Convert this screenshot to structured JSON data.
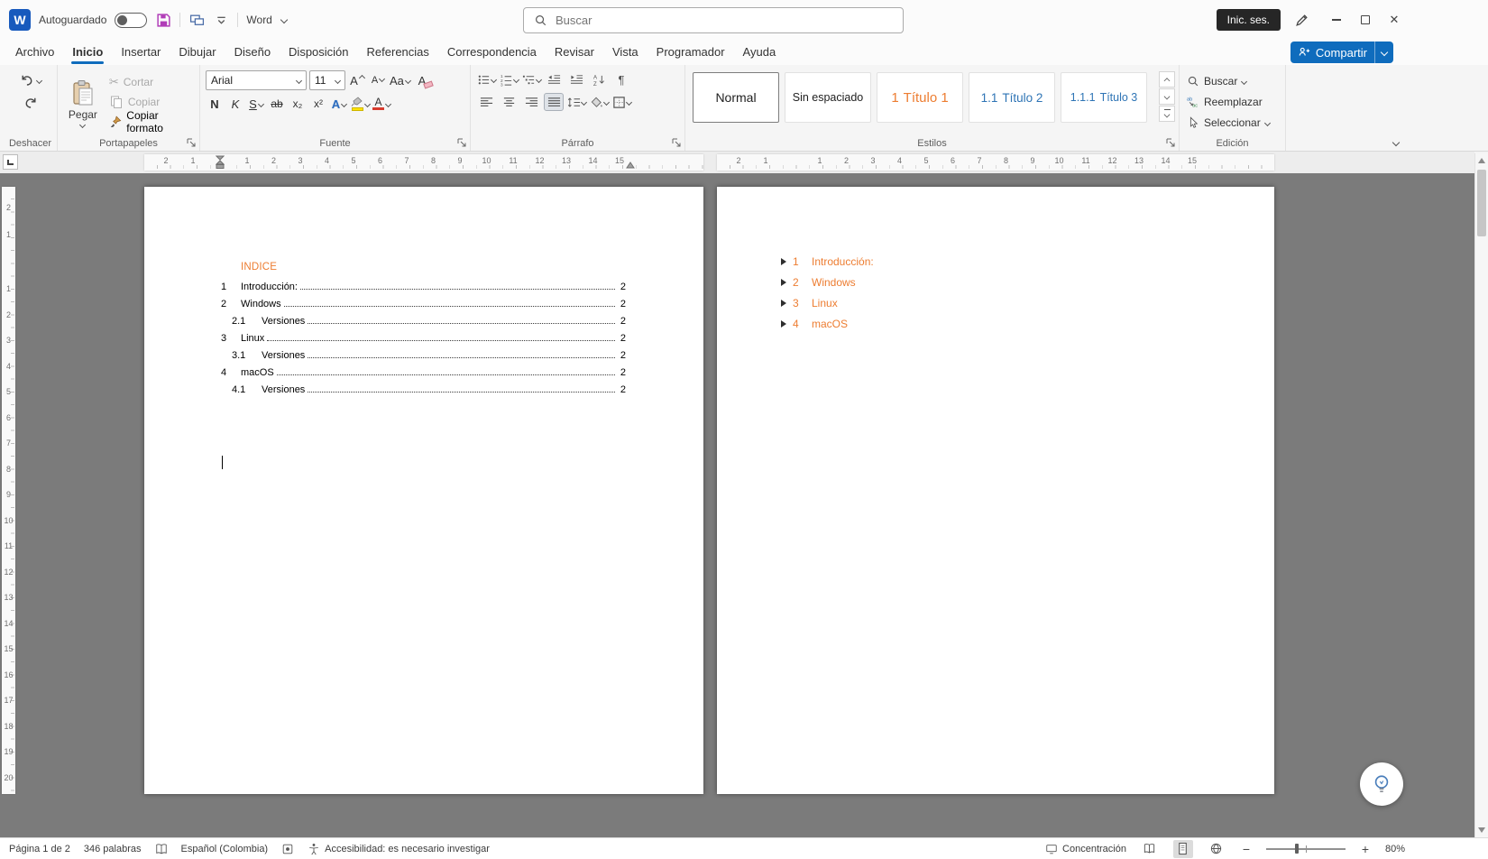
{
  "titlebar": {
    "autosave": "Autoguardado",
    "app_name": "Word",
    "search_placeholder": "Buscar",
    "signin": "Inic. ses."
  },
  "tabs": [
    {
      "label": "Archivo"
    },
    {
      "label": "Inicio"
    },
    {
      "label": "Insertar"
    },
    {
      "label": "Dibujar"
    },
    {
      "label": "Diseño"
    },
    {
      "label": "Disposición"
    },
    {
      "label": "Referencias"
    },
    {
      "label": "Correspondencia"
    },
    {
      "label": "Revisar"
    },
    {
      "label": "Vista"
    },
    {
      "label": "Programador"
    },
    {
      "label": "Ayuda"
    }
  ],
  "share": {
    "label": "Compartir"
  },
  "ribbon": {
    "groups": {
      "undo": "Deshacer",
      "clipboard": "Portapapeles",
      "font": "Fuente",
      "paragraph": "Párrafo",
      "styles": "Estilos",
      "editing": "Edición"
    },
    "clipboard": {
      "paste": "Pegar",
      "cut": "Cortar",
      "copy": "Copiar",
      "format_painter": "Copiar formato"
    },
    "font": {
      "family": "Arial",
      "size": "11",
      "grow": "A",
      "shrink": "A",
      "change_case": "Aa",
      "bold": "N",
      "italic": "K",
      "underline": "S",
      "strike": "ab",
      "subscript": "x₂",
      "superscript": "x²",
      "effects": "A",
      "font_color": "A"
    },
    "styles": [
      {
        "prefix": "",
        "label": "Normal"
      },
      {
        "prefix": "",
        "label": "Sin espaciado"
      },
      {
        "prefix": "1",
        "label": "Título 1"
      },
      {
        "prefix": "1.1",
        "label": "Título 2"
      },
      {
        "prefix": "1.1.1",
        "label": "Título 3"
      }
    ],
    "editing": {
      "find": "Buscar",
      "replace": "Reemplazar",
      "select": "Seleccionar"
    }
  },
  "ruler": {
    "h_numbers": [
      "1",
      "2",
      "3",
      "4",
      "5",
      "6",
      "7",
      "8",
      "9",
      "10",
      "11",
      "12",
      "13",
      "14",
      "15"
    ],
    "h_margin": [
      "2",
      "1"
    ],
    "v_numbers": [
      "1",
      "2",
      "3",
      "4",
      "5",
      "6",
      "7",
      "8",
      "9",
      "10",
      "11",
      "12",
      "13",
      "14",
      "15",
      "16",
      "17",
      "18",
      "19",
      "20"
    ],
    "v_margin": [
      "2",
      "1"
    ]
  },
  "document": {
    "title": "INDICE",
    "toc": [
      {
        "num": "1",
        "label": "Introducción:",
        "page": "2",
        "level": 0
      },
      {
        "num": "2",
        "label": "Windows",
        "page": "2",
        "level": 0
      },
      {
        "num": "2.1",
        "label": "Versiones",
        "page": "2",
        "level": 1
      },
      {
        "num": "3",
        "label": "Linux",
        "page": "2",
        "level": 0
      },
      {
        "num": "3.1",
        "label": "Versiones",
        "page": "2",
        "level": 1
      },
      {
        "num": "4",
        "label": "macOS",
        "page": "2",
        "level": 0
      },
      {
        "num": "4.1",
        "label": "Versiones",
        "page": "2",
        "level": 1
      }
    ],
    "outline": [
      {
        "num": "1",
        "label": "Introducción:"
      },
      {
        "num": "2",
        "label": "Windows"
      },
      {
        "num": "3",
        "label": "Linux"
      },
      {
        "num": "4",
        "label": "macOS"
      }
    ]
  },
  "statusbar": {
    "page": "Página 1 de 2",
    "words": "346 palabras",
    "language": "Español (Colombia)",
    "accessibility": "Accesibilidad: es necesario investigar",
    "focus": "Concentración",
    "zoom": "80%"
  },
  "colors": {
    "accent_orange": "#ED7D31",
    "accent_blue": "#2E74B5",
    "share_blue": "#0F6CBD"
  }
}
